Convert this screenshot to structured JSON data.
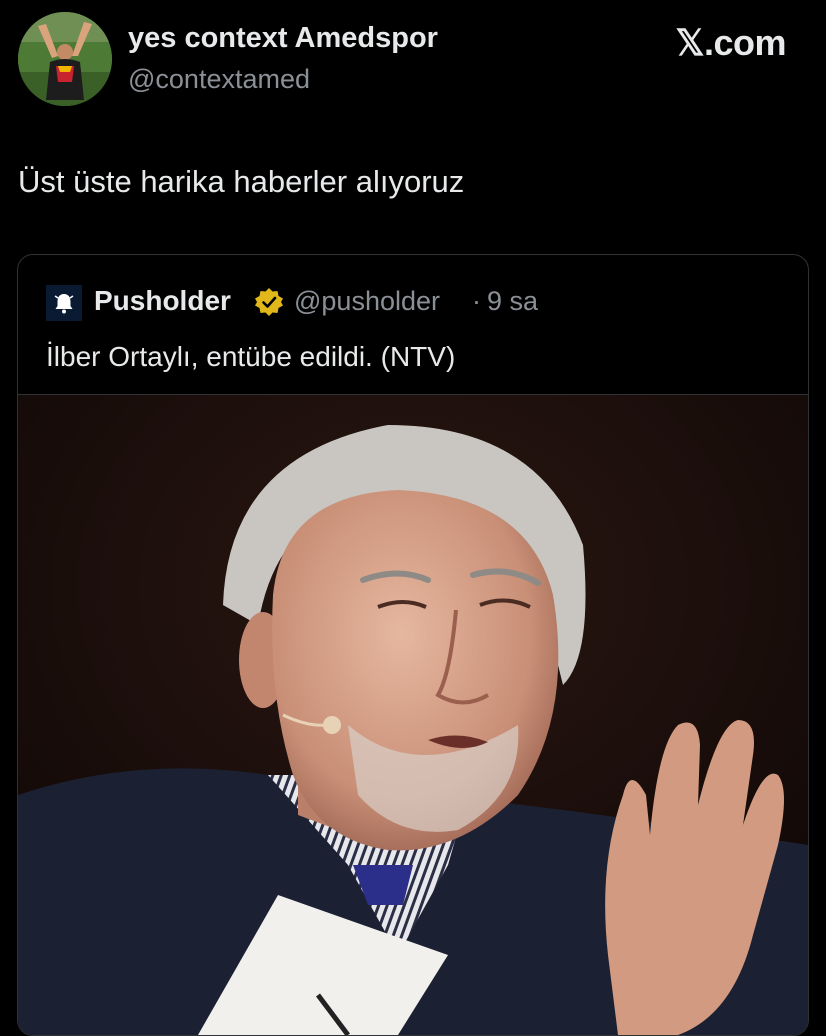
{
  "tweet": {
    "author_name": "yes context Amedspor",
    "author_handle": "@contextamed",
    "avatar_icon": "profile-photo-celebrating-player",
    "text": "Üst üste harika haberler alıyoruz"
  },
  "brand": {
    "label": "𝕏.com"
  },
  "quote": {
    "author_name": "Pusholder",
    "author_handle": "@pusholder",
    "separator": "·",
    "time": "9 sa",
    "verified_icon": "gold-verified-badge-icon",
    "avatar_icon": "bell-icon",
    "text": "İlber Ortaylı, entübe edildi. (NTV)",
    "media_icon": "photo-elderly-man-speaking-with-microphone"
  },
  "colors": {
    "background": "#000000",
    "primary_text": "#e7e9ea",
    "secondary_text": "#8b9096",
    "border": "#2f3336",
    "verified_gold": "#e2b719"
  }
}
